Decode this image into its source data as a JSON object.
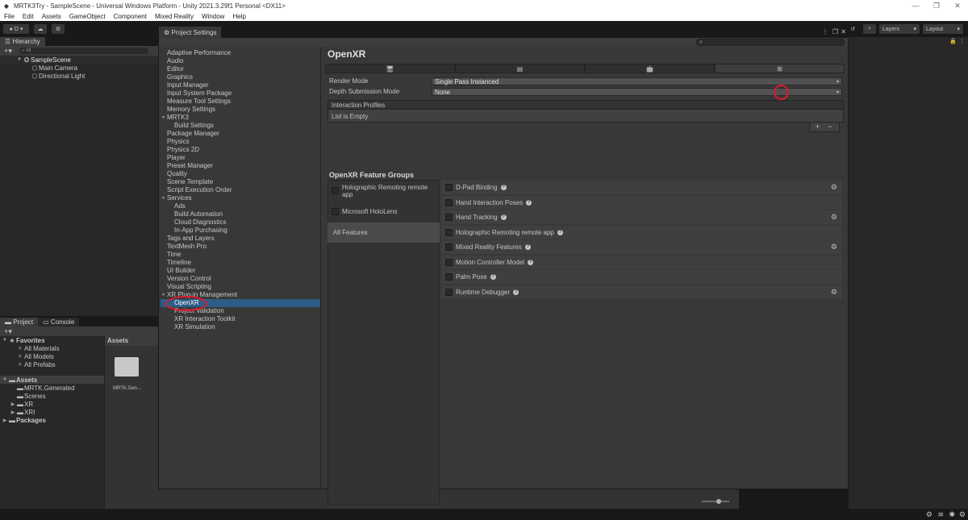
{
  "os_window": {
    "title": "MRTK3Try - SampleScene - Universal Windows Platform - Unity 2021.3.29f1 Personal <DX11>",
    "menu": [
      "File",
      "Edit",
      "Assets",
      "GameObject",
      "Component",
      "Mixed Reality",
      "Window",
      "Help"
    ]
  },
  "toolbar": {
    "account_label": "D",
    "layers_label": "Layers",
    "layout_label": "Layout"
  },
  "hierarchy": {
    "tab_label": "Hierarchy",
    "search_placeholder": "All",
    "scene_name": "SampleScene",
    "items": [
      "Main Camera",
      "Directional Light"
    ]
  },
  "project_panel": {
    "tabs": [
      "Project",
      "Console"
    ],
    "favorites_label": "Favorites",
    "favorites": [
      "All Materials",
      "All Models",
      "All Prefabs"
    ],
    "assets_label": "Assets",
    "asset_folders": [
      "MRTK.Generated",
      "Scenes",
      "XR",
      "XRI"
    ],
    "packages_label": "Packages",
    "assets_header": "Assets",
    "tile_label": "MRTK.Gen..."
  },
  "project_settings": {
    "tab_label": "Project Settings",
    "categories": [
      {
        "label": "Adaptive Performance",
        "indent": 0
      },
      {
        "label": "Audio",
        "indent": 0
      },
      {
        "label": "Editor",
        "indent": 0
      },
      {
        "label": "Graphics",
        "indent": 0
      },
      {
        "label": "Input Manager",
        "indent": 0
      },
      {
        "label": "Input System Package",
        "indent": 0
      },
      {
        "label": "Measure Tool Settings",
        "indent": 0
      },
      {
        "label": "Memory Settings",
        "indent": 0
      },
      {
        "label": "MRTK3",
        "indent": 0,
        "foldout": true
      },
      {
        "label": "Build Settings",
        "indent": 1
      },
      {
        "label": "Package Manager",
        "indent": 0
      },
      {
        "label": "Physics",
        "indent": 0
      },
      {
        "label": "Physics 2D",
        "indent": 0
      },
      {
        "label": "Player",
        "indent": 0
      },
      {
        "label": "Preset Manager",
        "indent": 0
      },
      {
        "label": "Quality",
        "indent": 0
      },
      {
        "label": "Scene Template",
        "indent": 0
      },
      {
        "label": "Script Execution Order",
        "indent": 0
      },
      {
        "label": "Services",
        "indent": 0,
        "foldout": true
      },
      {
        "label": "Ads",
        "indent": 1
      },
      {
        "label": "Build Automation",
        "indent": 1
      },
      {
        "label": "Cloud Diagnostics",
        "indent": 1
      },
      {
        "label": "In-App Purchasing",
        "indent": 1
      },
      {
        "label": "Tags and Layers",
        "indent": 0
      },
      {
        "label": "TextMesh Pro",
        "indent": 0
      },
      {
        "label": "Time",
        "indent": 0
      },
      {
        "label": "Timeline",
        "indent": 0
      },
      {
        "label": "UI Builder",
        "indent": 0
      },
      {
        "label": "Version Control",
        "indent": 0
      },
      {
        "label": "Visual Scripting",
        "indent": 0
      },
      {
        "label": "XR Plug-in Management",
        "indent": 0,
        "foldout": true
      },
      {
        "label": "OpenXR",
        "indent": 1,
        "selected": true
      },
      {
        "label": "Project Validation",
        "indent": 1
      },
      {
        "label": "XR Interaction Toolkit",
        "indent": 1
      },
      {
        "label": "XR Simulation",
        "indent": 1
      }
    ],
    "page_title": "OpenXR",
    "platform_tabs": [
      {
        "icon": "desktop-icon",
        "glyph": "🖥",
        "active": false
      },
      {
        "icon": "webgl-icon",
        "glyph": "▤",
        "active": false
      },
      {
        "icon": "android-icon",
        "glyph": "🤖",
        "active": false
      },
      {
        "icon": "windows-icon",
        "glyph": "⊞",
        "active": true
      }
    ],
    "render_mode_label": "Render Mode",
    "render_mode_value": "Single Pass Instanced",
    "depth_mode_label": "Depth Submission Mode",
    "depth_mode_value": "None",
    "interaction_profiles_label": "Interaction Profiles",
    "list_empty_label": "List is Empty",
    "add_label": "+",
    "remove_label": "−",
    "feature_groups_label": "OpenXR Feature Groups",
    "groups": [
      {
        "label": "Holographic Remoting remote app",
        "checkbox": true,
        "selected": false
      },
      {
        "label": "Microsoft HoloLens",
        "checkbox": true,
        "selected": false
      },
      {
        "label": "All Features",
        "checkbox": false,
        "selected": true
      }
    ],
    "features": [
      {
        "label": "D-Pad Binding",
        "gear": true
      },
      {
        "label": "Hand Interaction Poses",
        "gear": false
      },
      {
        "label": "Hand Tracking",
        "gear": true
      },
      {
        "label": "Holographic Remoting remote app",
        "gear": false
      },
      {
        "label": "Mixed Reality Features",
        "gear": true
      },
      {
        "label": "Motion Controller Model",
        "gear": false
      },
      {
        "label": "Palm Pose",
        "gear": false
      },
      {
        "label": "Runtime Debugger",
        "gear": true
      }
    ]
  },
  "colors": {
    "selection": "#2c5d87",
    "highlight_circle": "#e0182c"
  }
}
